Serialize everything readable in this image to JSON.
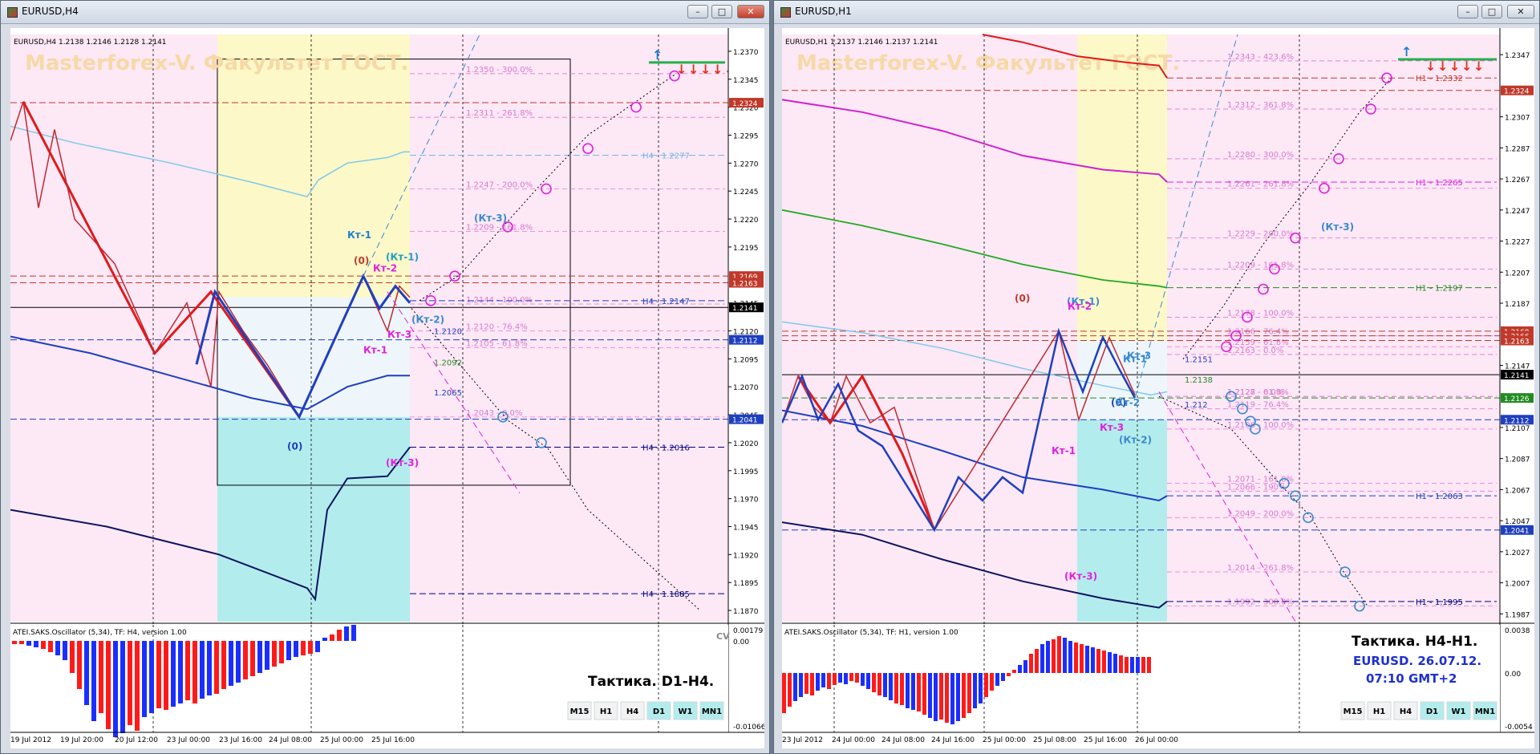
{
  "left": {
    "window_title": "EURUSD,H4",
    "info": "EURUSD,H4  1.2138 1.2146 1.2128 1.2141",
    "watermark": "Masterforex-V. Факультет ГОСТ.",
    "osc_label": "ATEI.SAKS.Oscillator (5,34), TF: H4, version 1.00",
    "tactic": "Тактика. D1-H4.",
    "cv": "CV",
    "price_axis": [
      {
        "label": "1.2370",
        "y": 1.237
      },
      {
        "label": "1.2345",
        "y": 1.2345
      },
      {
        "label": "1.2320",
        "y": 1.232
      },
      {
        "label": "1.2295",
        "y": 1.2295
      },
      {
        "label": "1.2270",
        "y": 1.227
      },
      {
        "label": "1.2245",
        "y": 1.2245
      },
      {
        "label": "1.2220",
        "y": 1.222
      },
      {
        "label": "1.2195",
        "y": 1.2195
      },
      {
        "label": "1.2145",
        "y": 1.2145
      },
      {
        "label": "1.2120",
        "y": 1.212
      },
      {
        "label": "1.2095",
        "y": 1.2095
      },
      {
        "label": "1.2070",
        "y": 1.207
      },
      {
        "label": "1.2045",
        "y": 1.2045
      },
      {
        "label": "1.2020",
        "y": 1.202
      },
      {
        "label": "1.1995",
        "y": 1.1995
      },
      {
        "label": "1.1970",
        "y": 1.197
      },
      {
        "label": "1.1945",
        "y": 1.1945
      },
      {
        "label": "1.1920",
        "y": 1.192
      },
      {
        "label": "1.1895",
        "y": 1.1895
      },
      {
        "label": "1.1870",
        "y": 1.187
      }
    ],
    "price_tags": [
      {
        "label": "1.2324",
        "y": 1.2324,
        "color": "#c0392b"
      },
      {
        "label": "1.2169",
        "y": 1.2169,
        "color": "#c0392b"
      },
      {
        "label": "1.2163",
        "y": 1.2163,
        "color": "#c0392b"
      },
      {
        "label": "1.2141",
        "y": 1.2141,
        "color": "#000000"
      },
      {
        "label": "1.2112",
        "y": 1.2112,
        "color": "#1f3fbf"
      },
      {
        "label": "1.2041",
        "y": 1.2041,
        "color": "#1f3fbf"
      }
    ],
    "osc_axis": [
      "0.00179",
      "0.00",
      "-0.01066"
    ],
    "time_axis": [
      "19 Jul 2012",
      "19 Jul 20:00",
      "20 Jul 12:00",
      "23 Jul 00:00",
      "23 Jul 16:00",
      "24 Jul 08:00",
      "25 Jul 00:00",
      "25 Jul 16:00"
    ],
    "fib": [
      {
        "label": "1.2350 - 300.0%",
        "y": 1.235
      },
      {
        "label": "1.2311 - 261.8%",
        "y": 1.2311
      },
      {
        "label": "1.2247 - 200.0%",
        "y": 1.2247
      },
      {
        "label": "1.2209 - 161.8%",
        "y": 1.2209
      },
      {
        "label": "1.2144 - 100.0%",
        "y": 1.2144
      },
      {
        "label": "1.2120 - 76.4%",
        "y": 1.212
      },
      {
        "label": "1.2105 - 61.8%",
        "y": 1.2105
      },
      {
        "label": "1.2043 - 0.0%",
        "y": 1.2043
      }
    ],
    "levels": [
      {
        "label": "H4 - 1.2277",
        "y": 1.2277,
        "color": "#6fb6e0"
      },
      {
        "label": "H4 - 1.2147",
        "y": 1.2147,
        "color": "#1f3fbf"
      },
      {
        "label": "H4 - 1.2016",
        "y": 1.2016,
        "color": "#000080"
      },
      {
        "label": "H4 - 1.1885",
        "y": 1.1885,
        "color": "#000080"
      }
    ],
    "misc_labels": [
      {
        "text": "1.2120",
        "y": 1.212,
        "color": "#1f3fbf"
      },
      {
        "text": "1.2092",
        "y": 1.2092,
        "color": "#228b22"
      },
      {
        "text": "1.2065",
        "y": 1.2065,
        "color": "#1f3fbf"
      }
    ],
    "wave_labels": [
      {
        "text": "Кт-1",
        "color": "#1f7fd0"
      },
      {
        "text": "(0)",
        "color": "#c0392b"
      },
      {
        "text": "Кт-2",
        "color": "#e020e0"
      },
      {
        "text": "(Кт-1)",
        "color": "#1f9fbf"
      },
      {
        "text": "(Кт-3)",
        "color": "#3a8ad0"
      },
      {
        "text": "(Кт-2)",
        "color": "#3a8ad0"
      },
      {
        "text": "Кт-3",
        "color": "#e020e0"
      },
      {
        "text": "Кт-1",
        "color": "#e020e0"
      },
      {
        "text": "(0)",
        "color": "#1f3fbf"
      },
      {
        "text": "(Кт-3)",
        "color": "#e020e0"
      }
    ],
    "tf_buttons": [
      {
        "label": "M15",
        "active": false
      },
      {
        "label": "H1",
        "active": false
      },
      {
        "label": "H4",
        "active": false
      },
      {
        "label": "D1",
        "active": true
      },
      {
        "label": "W1",
        "active": true
      },
      {
        "label": "MN1",
        "active": true
      }
    ]
  },
  "right": {
    "window_title": "EURUSD,H1",
    "info": "EURUSD,H1  1.2137 1.2146 1.2137 1.2141",
    "watermark": "Masterforex-V. Факультет ГОСТ.",
    "osc_label": "ATEI.SAKS.Oscillator (5,34), TF: H1, version 1.00",
    "tactic": "Тактика. H4-H1.",
    "pair_date": "EURUSD. 26.07.12.",
    "time_gmt": "07:10  GMT+2",
    "price_axis": [
      {
        "label": "1.2347",
        "y": 1.2347
      },
      {
        "label": "1.2307",
        "y": 1.2307
      },
      {
        "label": "1.2287",
        "y": 1.2287
      },
      {
        "label": "1.2267",
        "y": 1.2267
      },
      {
        "label": "1.2247",
        "y": 1.2247
      },
      {
        "label": "1.2227",
        "y": 1.2227
      },
      {
        "label": "1.2207",
        "y": 1.2207
      },
      {
        "label": "1.2187",
        "y": 1.2187
      },
      {
        "label": "1.2147",
        "y": 1.2147
      },
      {
        "label": "1.2107",
        "y": 1.2107
      },
      {
        "label": "1.2087",
        "y": 1.2087
      },
      {
        "label": "1.2067",
        "y": 1.2067
      },
      {
        "label": "1.2047",
        "y": 1.2047
      },
      {
        "label": "1.2027",
        "y": 1.2027
      },
      {
        "label": "1.2007",
        "y": 1.2007
      },
      {
        "label": "1.1987",
        "y": 1.1987
      }
    ],
    "price_tags": [
      {
        "label": "1.2324",
        "y": 1.2324,
        "color": "#c0392b"
      },
      {
        "label": "1.2169",
        "y": 1.2169,
        "color": "#c0392b"
      },
      {
        "label": "1.2166",
        "y": 1.2166,
        "color": "#c0392b"
      },
      {
        "label": "1.2163",
        "y": 1.2163,
        "color": "#c0392b"
      },
      {
        "label": "1.2141",
        "y": 1.2141,
        "color": "#000000"
      },
      {
        "label": "1.2126",
        "y": 1.2126,
        "color": "#228b22"
      },
      {
        "label": "1.2112",
        "y": 1.2112,
        "color": "#1f3fbf"
      },
      {
        "label": "1.2041",
        "y": 1.2041,
        "color": "#1f3fbf"
      }
    ],
    "osc_axis": [
      "0.0038",
      "0.00",
      "-0.0054"
    ],
    "time_axis": [
      "23 Jul 2012",
      "24 Jul 00:00",
      "24 Jul 08:00",
      "24 Jul 16:00",
      "25 Jul 00:00",
      "25 Jul 08:00",
      "25 Jul 16:00",
      "26 Jul 00:00"
    ],
    "fib": [
      {
        "label": "1.2343 - 423.6%",
        "y": 1.2343
      },
      {
        "label": "1.2312 - 361.8%",
        "y": 1.2312
      },
      {
        "label": "1.2280 - 300.0%",
        "y": 1.228
      },
      {
        "label": "1.2261 - 261.8%",
        "y": 1.2261
      },
      {
        "label": "1.2229 - 200.0%",
        "y": 1.2229
      },
      {
        "label": "1.2209 - 161.8%",
        "y": 1.2209
      },
      {
        "label": "1.2178 - 100.0%",
        "y": 1.2178
      },
      {
        "label": "1.2166 - 76.4%",
        "y": 1.2166
      },
      {
        "label": "1.2159 - 61.8%",
        "y": 1.2159
      },
      {
        "label": "1.2163 - 0.0%",
        "y": 1.2154
      },
      {
        "label": "1.2127 - 0.0%",
        "y": 1.2127
      },
      {
        "label": "1.2128 - 61.8%",
        "y": 1.2127
      },
      {
        "label": "1.2119 - 76.4%",
        "y": 1.2119
      },
      {
        "label": "1.2106 - 100.0%",
        "y": 1.2106
      },
      {
        "label": "1.2071 - 161.8%",
        "y": 1.2071
      },
      {
        "label": "1.2066 - 190%",
        "y": 1.2066
      },
      {
        "label": "1.2049 - 200.0%",
        "y": 1.2049
      },
      {
        "label": "1.2014 - 261.8%",
        "y": 1.2014
      },
      {
        "label": "1.1992 - 300.0%",
        "y": 1.1992
      }
    ],
    "levels": [
      {
        "label": "H1 - 1.2332",
        "y": 1.2332,
        "color": "#c0392b"
      },
      {
        "label": "H1 - 1.2265",
        "y": 1.2265,
        "color": "#e020e0"
      },
      {
        "label": "H1 - 1.2197",
        "y": 1.2197,
        "color": "#228b22"
      },
      {
        "label": "H1 - 1.2063",
        "y": 1.2063,
        "color": "#1f3fbf"
      },
      {
        "label": "H1 - 1.1995",
        "y": 1.1995,
        "color": "#000080"
      }
    ],
    "misc_labels": [
      {
        "text": "1.2151",
        "y": 1.2151,
        "color": "#1f3fbf"
      },
      {
        "text": "1.2138",
        "y": 1.2138,
        "color": "#228b22"
      },
      {
        "text": "1.212",
        "y": 1.2122,
        "color": "#1f3fbf"
      }
    ],
    "wave_labels": [
      {
        "text": "(0)",
        "color": "#c0392b"
      },
      {
        "text": "(Кт-1)",
        "color": "#3a8ad0"
      },
      {
        "text": "Кт-2",
        "color": "#e020e0"
      },
      {
        "text": "Кт-1",
        "color": "#3a8ad0"
      },
      {
        "text": "Кт-3",
        "color": "#3a8ad0"
      },
      {
        "text": "(0)",
        "color": "#1f3fbf"
      },
      {
        "text": "Кт-2",
        "color": "#3a8ad0"
      },
      {
        "text": "Кт-3",
        "color": "#e020e0"
      },
      {
        "text": "(Кт-2)",
        "color": "#3a8ad0"
      },
      {
        "text": "Кт-1",
        "color": "#e020e0"
      },
      {
        "text": "(Кт-3)",
        "color": "#3a8ad0"
      },
      {
        "text": "(Кт-3)",
        "color": "#e020e0"
      }
    ],
    "tf_buttons": [
      {
        "label": "M15",
        "active": false
      },
      {
        "label": "H1",
        "active": false
      },
      {
        "label": "H4",
        "active": false
      },
      {
        "label": "D1",
        "active": true
      },
      {
        "label": "W1",
        "active": true
      },
      {
        "label": "MN1",
        "active": true
      }
    ]
  }
}
